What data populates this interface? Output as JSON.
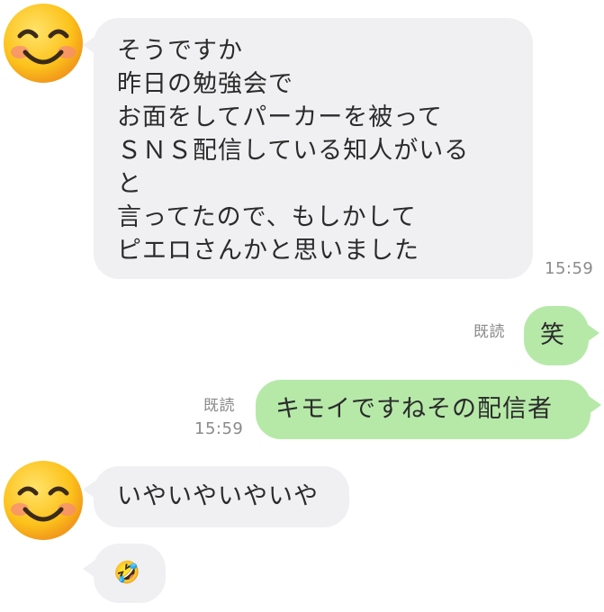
{
  "messages": {
    "msg1": {
      "lines": [
        "そうですか",
        "昨日の勉強会で",
        "お面をしてパーカーを被って",
        "ＳＮＳ配信している知人がいる",
        "と",
        "言ってたので、もしかして",
        "ピエロさんかと思いました"
      ],
      "time": "15:59"
    },
    "msg2": {
      "text": "笑",
      "read": "既読"
    },
    "msg3": {
      "text": "キモイですねその配信者",
      "read": "既読",
      "time": "15:59"
    },
    "msg4": {
      "text": "いやいやいやいや"
    },
    "msg5": {
      "text": "🤣"
    }
  },
  "colors": {
    "incoming_bubble": "#f0f0f2",
    "outgoing_bubble": "#b6e9a8",
    "meta_text": "#8a8a8a"
  },
  "icons": {
    "avatar": "smiling-face-emoji-icon"
  }
}
